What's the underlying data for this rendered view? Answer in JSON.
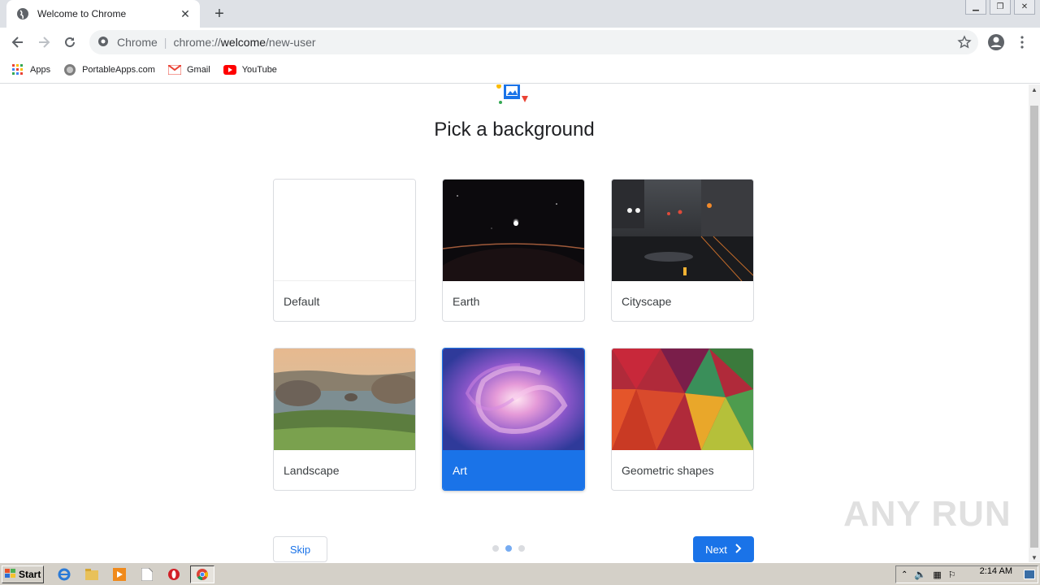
{
  "tab": {
    "title": "Welcome to Chrome"
  },
  "omnibox": {
    "chip": "Chrome",
    "url_host": "chrome://",
    "url_bold": "welcome",
    "url_path": "/new-user"
  },
  "bookmarks": [
    {
      "label": "Apps",
      "icon": "apps-grid-icon"
    },
    {
      "label": "PortableApps.com",
      "icon": "portableapps-icon"
    },
    {
      "label": "Gmail",
      "icon": "gmail-icon"
    },
    {
      "label": "YouTube",
      "icon": "youtube-icon"
    }
  ],
  "page": {
    "title": "Pick a background",
    "cards": [
      {
        "label": "Default"
      },
      {
        "label": "Earth"
      },
      {
        "label": "Cityscape"
      },
      {
        "label": "Landscape"
      },
      {
        "label": "Art"
      },
      {
        "label": "Geometric shapes"
      }
    ],
    "selected_card": "Art",
    "skip_label": "Skip",
    "next_label": "Next",
    "step": 2,
    "steps_total": 3
  },
  "watermark": "ANY RUN",
  "taskbar": {
    "start_label": "Start",
    "clock": "2:14 AM"
  },
  "colors": {
    "accent": "#1a73e8"
  }
}
